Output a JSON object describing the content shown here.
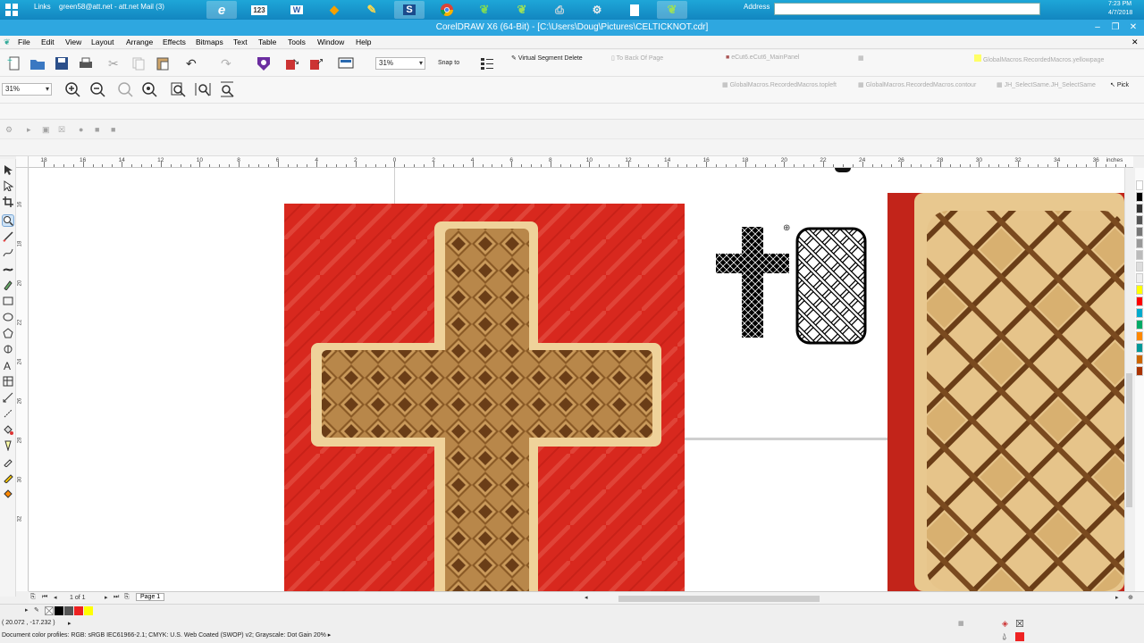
{
  "taskbar": {
    "links_label": "Links",
    "mail_label": "green58@att.net - att.net Mail (3)",
    "address_label": "Address",
    "time": "7:23 PM",
    "date": "4/7/2018"
  },
  "window": {
    "title": "CorelDRAW X6 (64-Bit) - [C:\\Users\\Doug\\Pictures\\CELTICKNOT.cdr]"
  },
  "menu": [
    "File",
    "Edit",
    "View",
    "Layout",
    "Arrange",
    "Effects",
    "Bitmaps",
    "Text",
    "Table",
    "Tools",
    "Window",
    "Help"
  ],
  "toolbar": {
    "zoom_value": "31%",
    "snap_to": "Snap to",
    "virtual_segment_delete": "Virtual Segment Delete",
    "to_back_of_page": "To Back Of Page",
    "ecut_panel": "eCut6.eCut6_MainPanel",
    "yellow_page_macro": "GlobalMacros.RecordedMacros.yellowpage"
  },
  "toolbar2": {
    "zoom_value": "31%",
    "macro_topleft": "GlobalMacros.RecordedMacros.topleft",
    "macro_contour": "GlobalMacros.RecordedMacros.contour",
    "macro_select_same": "JH_SelectSame.JH_SelectSame",
    "pick_label": "Pick"
  },
  "ruler": {
    "h_labels": [
      "18",
      "16",
      "14",
      "12",
      "10",
      "8",
      "6",
      "4",
      "2",
      "0",
      "2",
      "4",
      "6",
      "8",
      "10",
      "12",
      "14",
      "16",
      "18",
      "20",
      "22",
      "24",
      "26",
      "28",
      "30",
      "32",
      "34",
      "36"
    ],
    "units": "inches",
    "v_labels": [
      "16",
      "18",
      "20",
      "22",
      "24",
      "26",
      "28",
      "30",
      "32"
    ]
  },
  "page_nav": {
    "page_count": "1 of 1",
    "page_tab": "Page 1"
  },
  "status": {
    "coordinates": "( 20.072 , -17.232 )",
    "color_profiles": "Document color profiles: RGB: sRGB IEC61966-2.1; CMYK: U.S. Web Coated (SWOP) v2; Grayscale: Dot Gain 20%"
  },
  "colors": {
    "accent": "#2ea7e0",
    "red_fabric": "#d8281e",
    "wood_light": "#e6c48a",
    "wood_dark": "#6a3d17"
  },
  "palette_colors": [
    "#ffffff",
    "#000000",
    "#333333",
    "#555555",
    "#777777",
    "#999999",
    "#bbbbbb",
    "#dddddd",
    "#eeeeee",
    "#ffff00",
    "#ff0000",
    "#00aacc",
    "#00aa66",
    "#ff8800",
    "#009999",
    "#cc6600",
    "#aa3300"
  ]
}
